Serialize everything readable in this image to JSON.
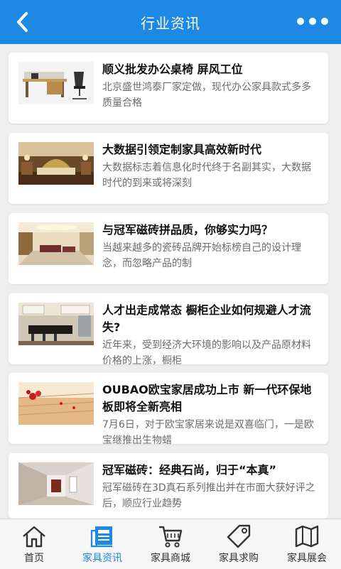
{
  "header": {
    "title": "行业资讯",
    "back_icon": "back-arrow-icon",
    "more_icon": "more-dots-icon"
  },
  "articles": [
    {
      "title": "顺义批发办公桌椅 屏风工位",
      "desc": "北京盛世鸿泰厂家定做，现代办公家具款式多多质量合格"
    },
    {
      "title": "大数据引领定制家具高效新时代",
      "desc": "大数据标志着信息化时代终于名副其实，大数据时代的到来或将深刻"
    },
    {
      "title": "与冠军磁砖拼品质，你够实力吗？",
      "desc": "当越来越多的瓷砖品牌开始标榜自己的设计理念，而忽略产品的制"
    },
    {
      "title": "人才出走成常态 橱柜企业如何规避人才流失?",
      "desc": "近年来，受到经济大环境的影响以及产品原材料价格的上涨，橱柜"
    },
    {
      "title": "OUBAO欧宝家居成功上市 新一代环保地板即将全新亮相",
      "desc": "7月6日，对于欧宝家居来说是双喜临门，一是欧宝继推出生物蜡"
    },
    {
      "title": "冠军磁砖：经典石尚，归于“本真”",
      "desc": "冠军磁砖在3D真石系列推出并在市面大获好评之后，顺应行业趋势"
    }
  ],
  "tabs": [
    {
      "label": "首页",
      "icon": "home-icon"
    },
    {
      "label": "家具资讯",
      "icon": "news-icon"
    },
    {
      "label": "家具商城",
      "icon": "cart-icon"
    },
    {
      "label": "家具求购",
      "icon": "tag-icon"
    },
    {
      "label": "家具展会",
      "icon": "map-icon"
    }
  ],
  "colors": {
    "primary": "#1e88e5",
    "background": "#eeeeee"
  }
}
